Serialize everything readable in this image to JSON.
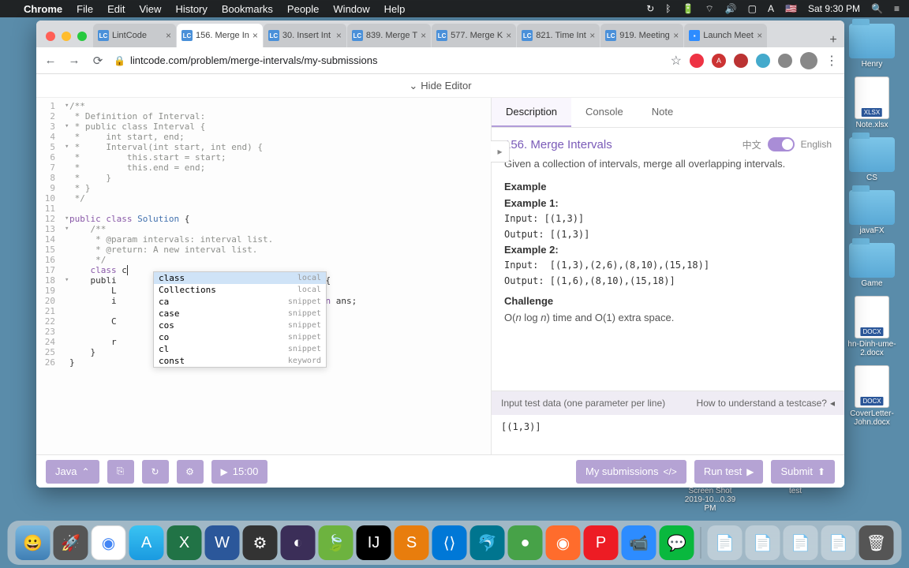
{
  "menubar": {
    "app": "Chrome",
    "items": [
      "File",
      "Edit",
      "View",
      "History",
      "Bookmarks",
      "People",
      "Window",
      "Help"
    ],
    "clock": "Sat 9:30 PM"
  },
  "tabs": [
    {
      "label": "LintCode",
      "favicon": "LC"
    },
    {
      "label": "156. Merge In",
      "favicon": "LC",
      "active": true
    },
    {
      "label": "30. Insert Int",
      "favicon": "LC"
    },
    {
      "label": "839. Merge T",
      "favicon": "LC"
    },
    {
      "label": "577. Merge K",
      "favicon": "LC"
    },
    {
      "label": "821. Time Int",
      "favicon": "LC"
    },
    {
      "label": "919. Meeting",
      "favicon": "LC"
    },
    {
      "label": "Launch Meet",
      "favicon": "Z",
      "zoom": true
    }
  ],
  "url": "lintcode.com/problem/merge-intervals/my-submissions",
  "hide_editor_label": "Hide Editor",
  "code": {
    "lines": [
      {
        "n": 1,
        "fold": "▾",
        "txt": "/**"
      },
      {
        "n": 2,
        "txt": " * Definition of Interval:"
      },
      {
        "n": 3,
        "fold": "▾",
        "txt": " * public class Interval {"
      },
      {
        "n": 4,
        "txt": " *     int start, end;"
      },
      {
        "n": 5,
        "fold": "▾",
        "txt": " *     Interval(int start, int end) {"
      },
      {
        "n": 6,
        "txt": " *         this.start = start;"
      },
      {
        "n": 7,
        "txt": " *         this.end = end;"
      },
      {
        "n": 8,
        "txt": " *     }"
      },
      {
        "n": 9,
        "txt": " * }"
      },
      {
        "n": 10,
        "txt": " */"
      },
      {
        "n": 11,
        "txt": ""
      },
      {
        "n": 12,
        "fold": "▾",
        "txt": "public class Solution {",
        "hl": true
      },
      {
        "n": 13,
        "fold": "▾",
        "txt": "    /**"
      },
      {
        "n": 14,
        "txt": "     * @param intervals: interval list."
      },
      {
        "n": 15,
        "txt": "     * @return: A new interval list."
      },
      {
        "n": 16,
        "txt": "     */"
      },
      {
        "n": 17,
        "txt": "    class c",
        "caret": true,
        "hl2": true
      },
      {
        "n": 18,
        "fold": "▾",
        "txt": "    publi                              ntervals) {"
      },
      {
        "n": 19,
        "txt": "        L                              val>();"
      },
      {
        "n": 20,
        "txt": "        i                           ) == 0) return ans;"
      },
      {
        "n": 21,
        "txt": "        "
      },
      {
        "n": 22,
        "txt": "        C"
      },
      {
        "n": 23,
        "txt": "        "
      },
      {
        "n": 24,
        "txt": "        r"
      },
      {
        "n": 25,
        "txt": "    }"
      },
      {
        "n": 26,
        "txt": "}"
      }
    ],
    "autocomplete": [
      {
        "word": "class",
        "kind": "local",
        "selected": true
      },
      {
        "word": "Collections",
        "kind": "local"
      },
      {
        "word": "ca",
        "kind": "snippet"
      },
      {
        "word": "case",
        "kind": "snippet"
      },
      {
        "word": "cos",
        "kind": "snippet"
      },
      {
        "word": "co",
        "kind": "snippet"
      },
      {
        "word": "cl",
        "kind": "snippet"
      },
      {
        "word": "const",
        "kind": "keyword"
      }
    ]
  },
  "problem": {
    "tabs": [
      "Description",
      "Console",
      "Note"
    ],
    "active_tab": 0,
    "title": "156. Merge Intervals",
    "lang": {
      "zh": "中文",
      "en": "English"
    },
    "description": "Given a collection of intervals, merge all overlapping intervals.",
    "example_h": "Example",
    "ex1_h": "Example 1:",
    "ex1_in": "Input: [(1,3)]",
    "ex1_out": "Output: [(1,3)]",
    "ex2_h": "Example 2:",
    "ex2_in": "Input:  [(1,3),(2,6),(8,10),(15,18)]",
    "ex2_out": "Output: [(1,6),(8,10),(15,18)]",
    "challenge_h": "Challenge",
    "challenge": "O(n log n) time and O(1) extra space.",
    "testcase_label": "Input test data (one parameter per line)",
    "testcase_help": "How to understand a testcase?",
    "testcase_value": "[(1,3)]"
  },
  "actions": {
    "lang": "Java",
    "timer": "15:00",
    "my_submissions": "My submissions",
    "run": "Run test",
    "submit": "Submit"
  },
  "desktop": [
    {
      "type": "folder",
      "label": "Henry"
    },
    {
      "type": "doc",
      "badge": "XLSX",
      "label": "Note.xlsx"
    },
    {
      "type": "folder",
      "label": "CS"
    },
    {
      "type": "folder",
      "label": "javaFX"
    },
    {
      "type": "folder",
      "label": "Game"
    },
    {
      "type": "doc",
      "badge": "DOCX",
      "label": "hn-Dinh-ume-2.docx"
    },
    {
      "type": "doc",
      "badge": "DOCX",
      "label": "CoverLetter-John.docx"
    }
  ],
  "desk_labels": {
    "screenshot": "Screen Shot 2019-10...0.39 PM",
    "test": "test"
  }
}
